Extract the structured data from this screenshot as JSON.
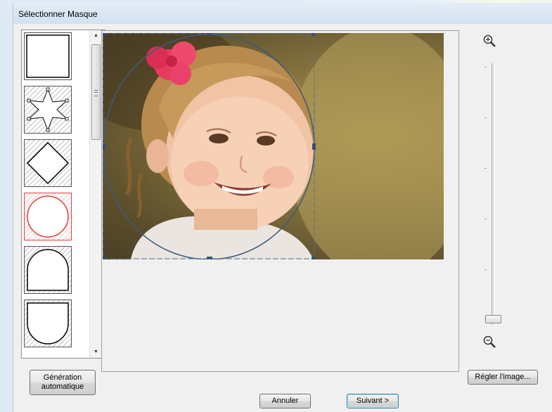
{
  "window": {
    "title": "Sélectionner Masque"
  },
  "masks": [
    {
      "name": "rectangle",
      "selected": false
    },
    {
      "name": "star",
      "selected": false
    },
    {
      "name": "diamond",
      "selected": false
    },
    {
      "name": "circle",
      "selected": true
    },
    {
      "name": "arch-top",
      "selected": false
    },
    {
      "name": "arch-bottom",
      "selected": false
    }
  ],
  "buttons": {
    "auto_generate_line1": "Génération",
    "auto_generate_line2": "automatique",
    "adjust_image": "Régler l'image...",
    "cancel": "Annuler",
    "next": "Suivant >"
  },
  "zoom": {
    "level": 0.02
  },
  "colors": {
    "selected_mask": "#e23a3a",
    "handle": "#35506e"
  }
}
